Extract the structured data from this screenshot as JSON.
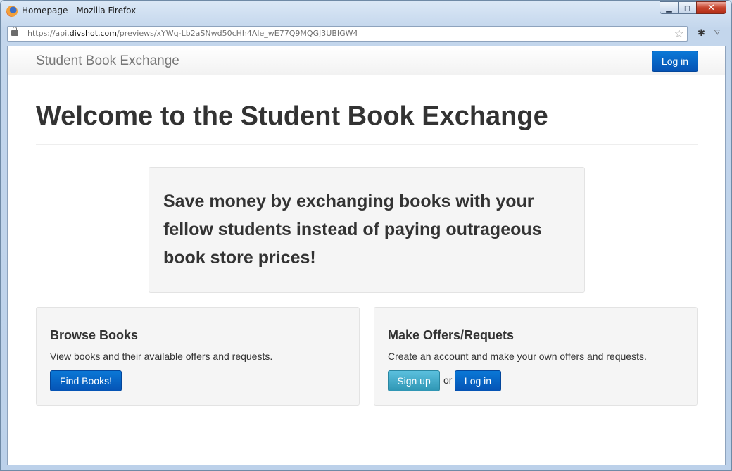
{
  "window": {
    "title": "Homepage - Mozilla Firefox",
    "url_prefix": "https://api.",
    "url_domain": "divshot.com",
    "url_rest": "/previews/xYWq-Lb2aSNwd50cHh4Ale_wE77Q9MQGJ3UBIGW4",
    "minimize": "▁",
    "maximize": "◻",
    "close": "✕"
  },
  "navbar": {
    "brand": "Student Book Exchange",
    "login_label": "Log in"
  },
  "main": {
    "title": "Welcome to the Student Book Exchange",
    "hero_text": "Save money by exchanging books with your fellow students instead of paying outrageous book store prices!"
  },
  "browse": {
    "heading": "Browse Books",
    "description": "View books and their available offers and requests.",
    "button_label": "Find Books!"
  },
  "offers": {
    "heading": "Make Offers/Requets",
    "description": "Create an account and make your own offers and requests.",
    "signup_label": "Sign up",
    "or_text": "or",
    "login_label": "Log in"
  },
  "icons": {
    "star": "☆",
    "addon": "✱",
    "caret": "▽"
  },
  "colors": {
    "primary": "#0553b5",
    "info": "#2f96b4",
    "text": "#333333"
  }
}
